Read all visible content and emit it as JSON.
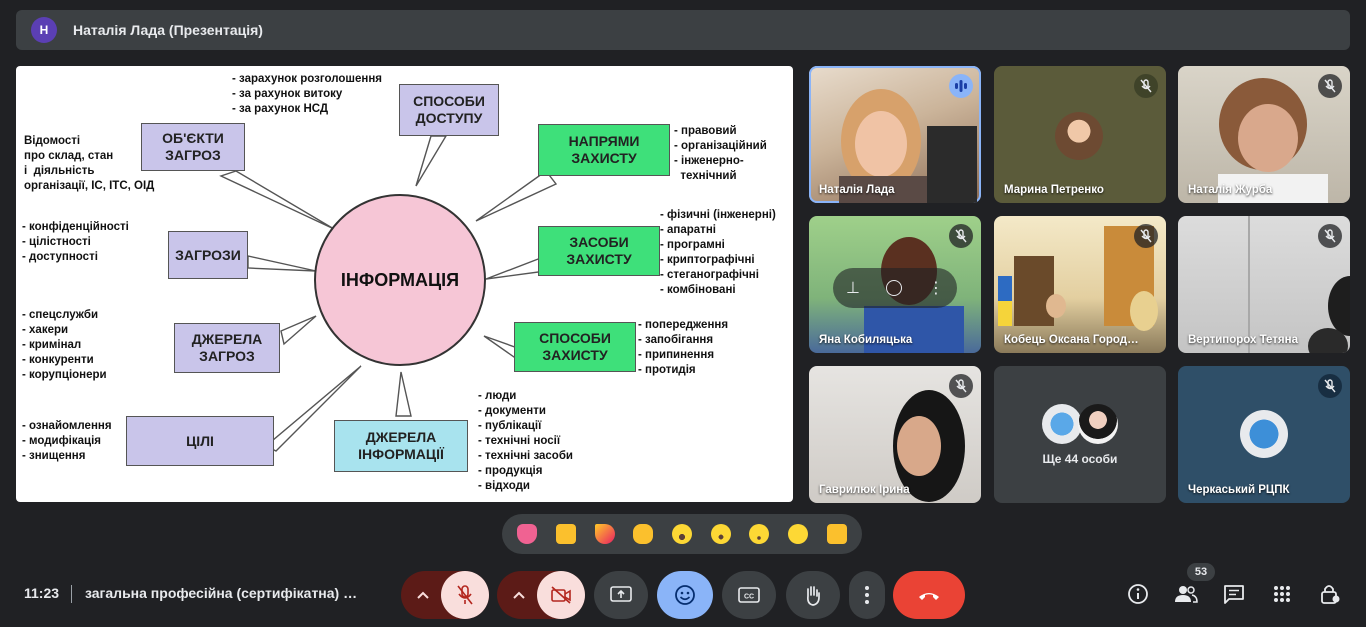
{
  "presenter_bar": {
    "avatar_letter": "Н",
    "title": "Наталія Лада (Презентація)"
  },
  "slide": {
    "center": "ІНФОРМАЦІЯ",
    "boxes": {
      "objects": "ОБ'ЄКТИ\nЗАГРОЗ",
      "access": "СПОСОБИ\nДОСТУПУ",
      "directions": "НАПРЯМИ\nЗАХИСТУ",
      "threats": "ЗАГРОЗИ",
      "means": "ЗАСОБИ\nЗАХИСТУ",
      "sources_threats": "ДЖЕРЕЛА\nЗАГРОЗ",
      "methods": "СПОСОБИ\nЗАХИСТУ",
      "goals": "ЦІЛІ",
      "sources_info": "ДЖЕРЕЛА\nІНФОРМАЦІЇ"
    },
    "lists": {
      "access": "- зарахунок розголошення\n- за рахунок витоку\n- за рахунок НСД",
      "objects": "Відомості\nпро склад, стан\nі  діяльність\nорганізації, ІС, ІТС, ОІД",
      "directions": "- правовий\n- організаційний\n- інженерно-\n  технічний",
      "threats": "- конфіденційності\n- цілістності\n- доступності",
      "means": "- фізичні (інженерні)\n- апаратні\n- програмні\n- криптографічні\n- стеганографічні\n- комбіновані",
      "sources_threats": "- спецслужби\n- хакери\n- кримінал\n- конкуренти\n- корупціонери",
      "methods": "- попередження\n- запобігання\n- припинення\n- протидія",
      "goals": "- ознайомлення\n- модифікація\n- знищення",
      "sources_info": "- люди\n- документи\n- публікації\n- технічні носії\n- технічні засоби\n- продукція\n- відходи"
    }
  },
  "participants": [
    {
      "name": "Наталія Лада",
      "state": "speaking"
    },
    {
      "name": "Марина Петренко",
      "state": "muted"
    },
    {
      "name": "Наталія Журба",
      "state": "muted"
    },
    {
      "name": "Яна Кобиляцька",
      "state": "muted"
    },
    {
      "name": "Кобець Оксана Город…",
      "state": "muted"
    },
    {
      "name": "Вертипорох Тетяна",
      "state": "muted"
    },
    {
      "name": "Гаврилюк Ірина",
      "state": "muted"
    },
    {
      "name": "Ще 44 особи",
      "state": "group"
    },
    {
      "name": "Черкаський РЦПК",
      "state": "muted"
    }
  ],
  "reactions": [
    "sparkling-heart",
    "thumbs-up",
    "party-popper",
    "clapping-hands",
    "tears-of-joy",
    "surprised",
    "sad",
    "thinking",
    "thumbs-down"
  ],
  "bottom_bar": {
    "time": "11:23",
    "meeting_title": "загальна професійна (сертифікатна) …",
    "people_count": "53"
  },
  "colors": {
    "background": "#202124",
    "danger": "#ea4335",
    "muted_btn": "#f9dedc",
    "accent_btn": "#8ab4f8"
  }
}
